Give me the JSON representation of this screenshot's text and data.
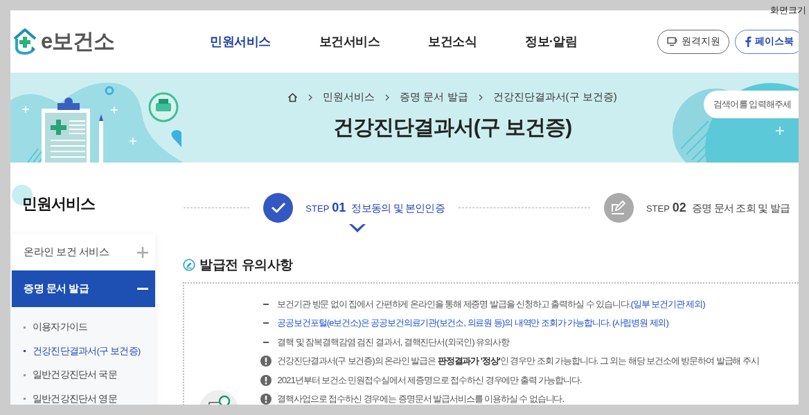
{
  "screen_size_label": "화면크기",
  "header": {
    "logo": "e보건소",
    "nav": [
      {
        "label": "민원서비스",
        "selected": true
      },
      {
        "label": "보건서비스",
        "selected": false
      },
      {
        "label": "보건소식",
        "selected": false
      },
      {
        "label": "정보·알림",
        "selected": false
      }
    ],
    "buttons": [
      {
        "label": "원격지원",
        "kind": "remote"
      },
      {
        "label": "페이스북",
        "kind": "facebook"
      }
    ]
  },
  "banner": {
    "breadcrumb": [
      "민원서비스",
      "증명 문서 발급",
      "건강진단결과서(구 보건증)"
    ],
    "title": "건강진단결과서(구 보건증)",
    "search": {
      "placeholder": "검색어를 입력해주세"
    }
  },
  "sidebar": {
    "title": "민원서비스",
    "items": [
      {
        "label": "온라인 보건 서비스",
        "expanded": false,
        "selected": false
      },
      {
        "label": "증명 문서 발급",
        "expanded": true,
        "selected": true,
        "children": [
          {
            "label": "이용자가이드",
            "selected": false
          },
          {
            "label": "건강진단결과서(구 보건증)",
            "selected": true
          },
          {
            "label": "일반건강진단서 국문",
            "selected": false
          },
          {
            "label": "일반건강진단서 영문",
            "selected": false
          }
        ]
      }
    ]
  },
  "steps": [
    {
      "step_label": "STEP",
      "number": "01",
      "title": "정보동의 및 본인인증",
      "selected": true
    },
    {
      "step_label": "STEP",
      "number": "02",
      "title": "증명 문서 조회 및 발급",
      "selected": false
    }
  ],
  "notice": {
    "title": "발급전 유의사항",
    "lines": [
      {
        "kind": "dash",
        "parts": [
          {
            "text": "보건기관 방문 없이 집에서 간편하게 온라인을 통해 제증명 발급을 신청하고 출력하실 수 있습니다.",
            "highlight": false
          },
          {
            "text": "(일부 보건기관 제외)",
            "highlight": true
          }
        ]
      },
      {
        "kind": "dash",
        "parts": [
          {
            "text": "공공보건포털(e보건소)은 공공보건의료기관(보건소, 의료원 등)의 내역만 조회가 가능합니다. (사립병원 제외)",
            "highlight": true
          }
        ]
      },
      {
        "kind": "dash",
        "parts": [
          {
            "text": "결핵 및 잠복결핵감염 검진 결과서, 결핵진단서(외국인) 유의사항",
            "highlight": false
          }
        ]
      },
      {
        "kind": "alert",
        "parts": [
          {
            "text": "건강진단결과서(구 보건증)의 온라인 발급은 **판정결과가 '정상'**인 경우만 조회 가능합니다. 그 외는 해당 보건소에 방문하여 발급해 주시",
            "highlight": false
          }
        ]
      },
      {
        "kind": "alert",
        "parts": [
          {
            "text": "2021년부터 보건소 민원접수실에서 제증명으로 접수하신 경우에만 출력 가능합니다.",
            "highlight": false
          }
        ]
      },
      {
        "kind": "alert",
        "parts": [
          {
            "text": "결핵사업으로 접수하신 경우에는 증명문서 발급서비스를 이용하실 수 없습니다.",
            "highlight": false
          }
        ]
      }
    ]
  }
}
